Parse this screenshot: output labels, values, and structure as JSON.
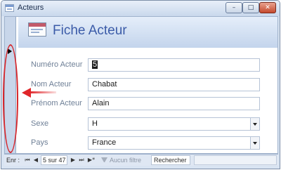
{
  "window": {
    "title": "Acteurs",
    "buttons": {
      "minimize": "–",
      "maximize": "□",
      "close": "✕"
    }
  },
  "form": {
    "title": "Fiche Acteur",
    "icon": "form-icon"
  },
  "fields": [
    {
      "label": "Numéro Acteur",
      "value": "5",
      "selected": true,
      "type": "text"
    },
    {
      "label": "Nom Acteur",
      "value": "Chabat",
      "type": "text"
    },
    {
      "label": "Prénom Acteur",
      "value": "Alain",
      "type": "text"
    },
    {
      "label": "Sexe",
      "value": "H",
      "type": "combo"
    },
    {
      "label": "Pays",
      "value": "France",
      "type": "combo"
    }
  ],
  "navigation": {
    "label": "Enr :",
    "record": "5 sur 47",
    "filter": "Aucun filtre",
    "search": "Rechercher"
  },
  "colors": {
    "annotation": "#d6262b",
    "header_title": "#3b5ba8",
    "label": "#6e7f96"
  }
}
